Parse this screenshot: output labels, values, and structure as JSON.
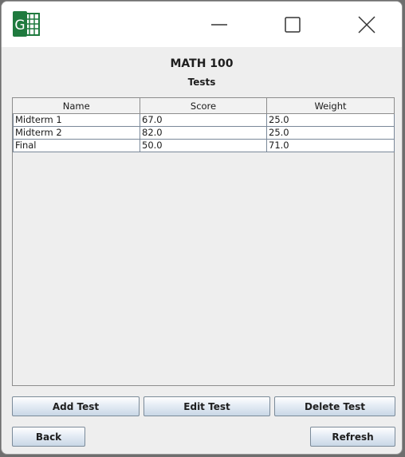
{
  "window": {
    "icon": "spreadsheet-g-app-icon",
    "controls": [
      "minimize-icon",
      "maximize-icon",
      "close-icon"
    ]
  },
  "header": {
    "title": "MATH 100",
    "subtitle": "Tests"
  },
  "table": {
    "columns": [
      "Name",
      "Score",
      "Weight"
    ],
    "rows": [
      [
        "Midterm 1",
        "67.0",
        "25.0"
      ],
      [
        "Midterm 2",
        "82.0",
        "25.0"
      ],
      [
        "Final",
        "50.0",
        "71.0"
      ]
    ]
  },
  "actions": {
    "add_label": "Add Test",
    "edit_label": "Edit Test",
    "delete_label": "Delete Test",
    "back_label": "Back",
    "refresh_label": "Refresh"
  },
  "colors": {
    "app_icon_green": "#1f7a3e",
    "window_bg": "#eeeeee",
    "titlebar_bg": "#ffffff"
  }
}
